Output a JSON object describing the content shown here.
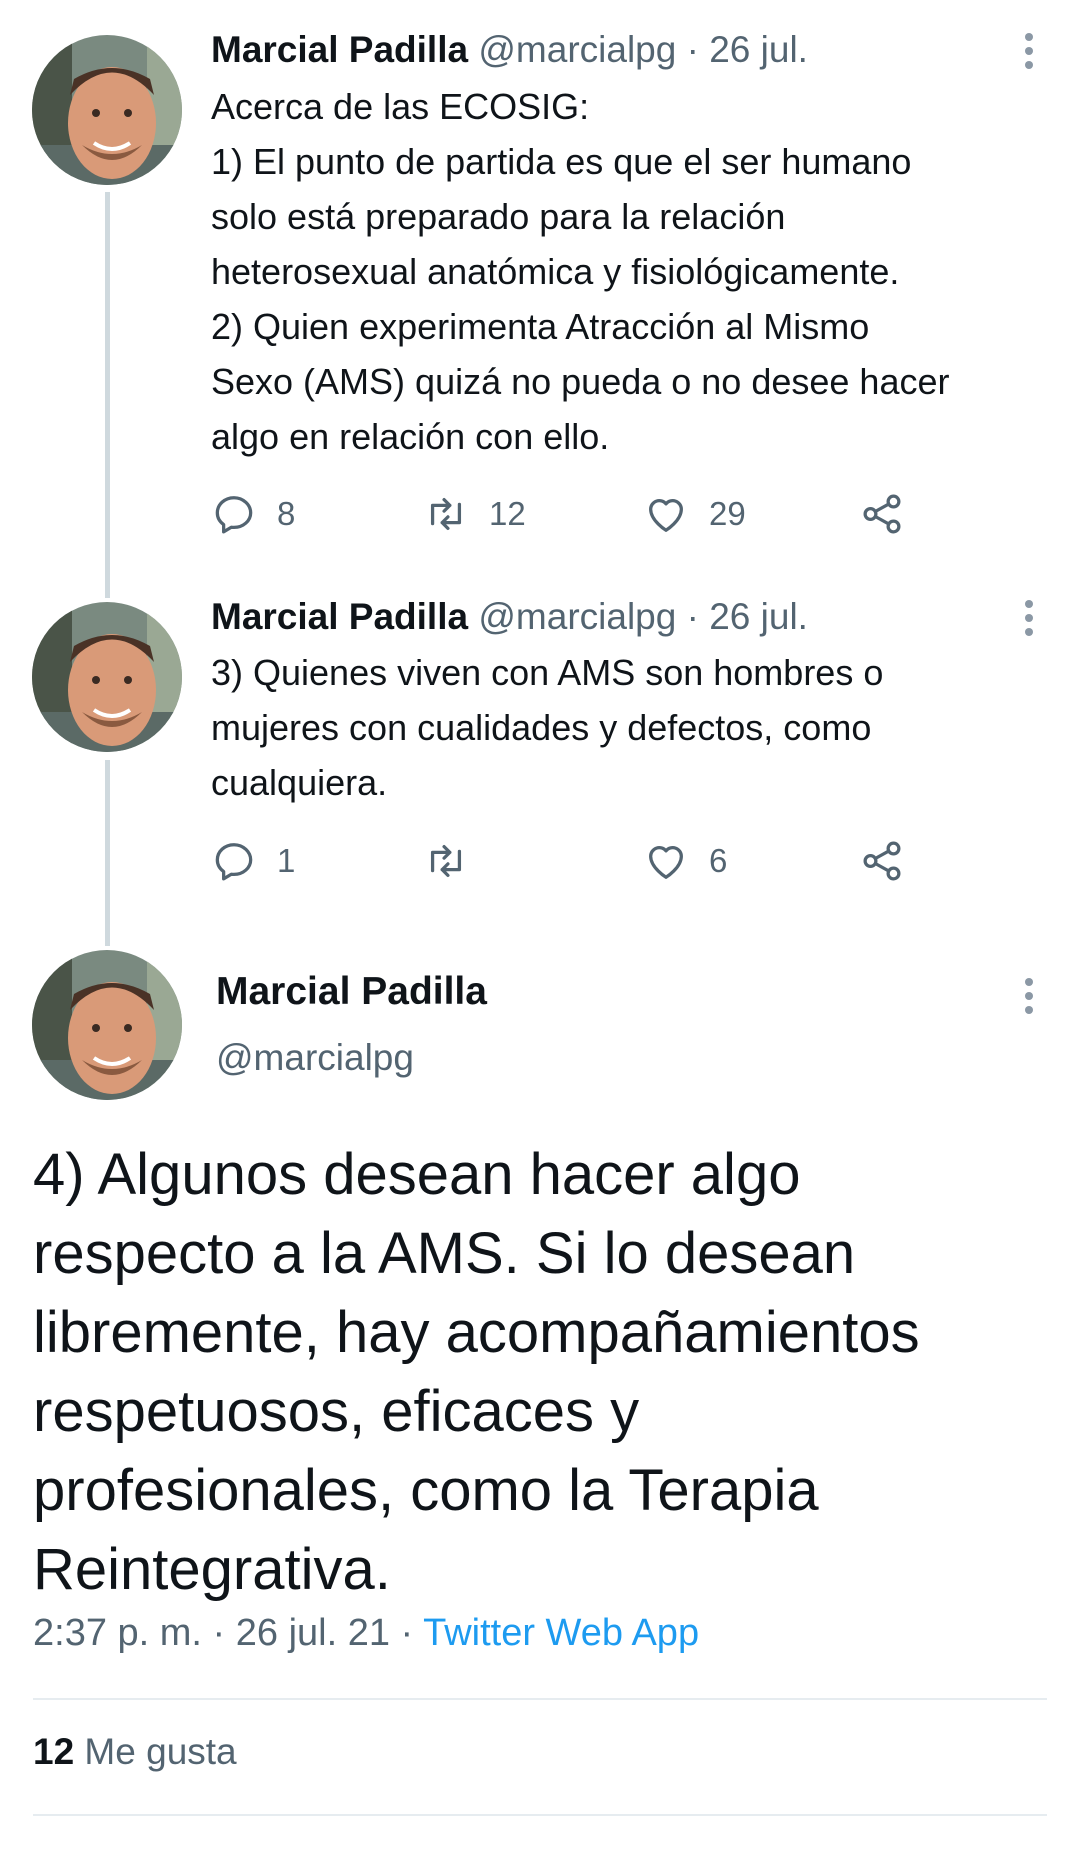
{
  "colors": {
    "text": "#0f1419",
    "muted": "#536471",
    "link": "#1d9bf0",
    "thread_line": "#cfd9de"
  },
  "tweets": [
    {
      "name": "Marcial Padilla",
      "handle": "@marcialpg",
      "sep": " · ",
      "date": "26 jul.",
      "lines": [
        "Acerca de las ECOSIG:",
        "1) El punto de partida es que el ser humano",
        "solo está preparado para la relación",
        "heterosexual anatómica y fisiológicamente.",
        "2) Quien experimenta Atracción al Mismo",
        "Sexo (AMS) quizá no pueda o no desee hacer",
        "algo en relación con ello."
      ],
      "replies": "8",
      "retweets": "12",
      "likes": "29",
      "icons": [
        "reply-icon",
        "retweet-icon",
        "like-icon",
        "share-icon",
        "more-icon"
      ]
    },
    {
      "name": "Marcial Padilla",
      "handle": "@marcialpg",
      "sep": " · ",
      "date": "26 jul.",
      "lines": [
        "3) Quienes viven con AMS son hombres o",
        "mujeres con cualidades y defectos, como",
        "cualquiera."
      ],
      "replies": "1",
      "retweets": "",
      "likes": "6",
      "icons": [
        "reply-icon",
        "retweet-icon",
        "like-icon",
        "share-icon",
        "more-icon"
      ]
    }
  ],
  "main_tweet": {
    "name": "Marcial Padilla",
    "handle": "@marcialpg",
    "lines": [
      "4) Algunos desean hacer algo",
      "respecto a la AMS. Si lo desean",
      "libremente, hay acompañamientos",
      "respetuosos, eficaces y",
      "profesionales, como la Terapia",
      "Reintegrativa."
    ],
    "time": "2:37 p. m.",
    "sep": " · ",
    "date": "26 jul. 21",
    "sep2": " · ",
    "source": "Twitter Web App",
    "likes_count": "12",
    "likes_label": " Me gusta"
  }
}
